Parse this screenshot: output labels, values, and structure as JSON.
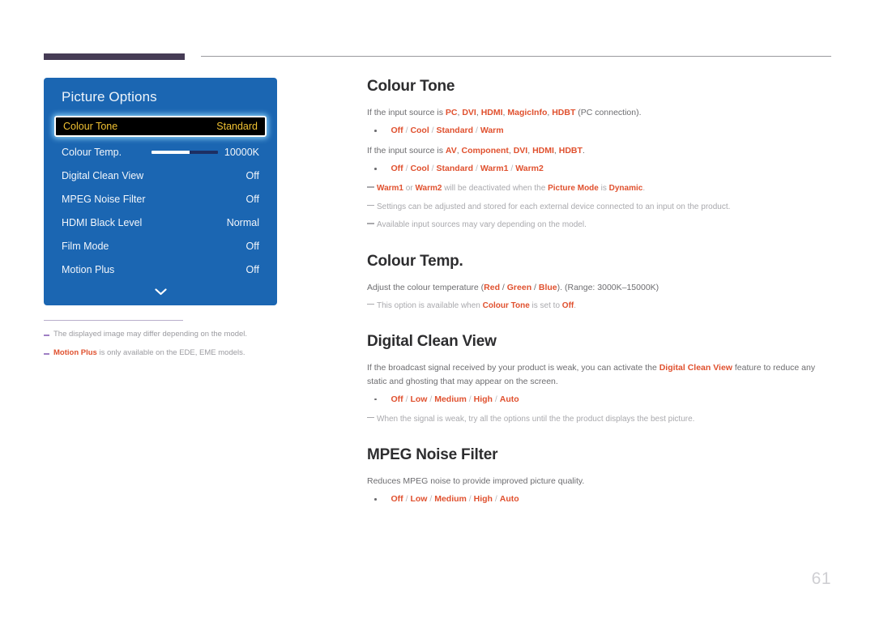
{
  "page": {
    "number": "61"
  },
  "osd": {
    "title": "Picture Options",
    "rows": [
      {
        "label": "Colour Tone",
        "value": "Standard",
        "selected": true,
        "slider": false
      },
      {
        "label": "Colour Temp.",
        "value": "10000K",
        "selected": false,
        "slider": true
      },
      {
        "label": "Digital Clean View",
        "value": "Off",
        "selected": false,
        "slider": false
      },
      {
        "label": "MPEG Noise Filter",
        "value": "Off",
        "selected": false,
        "slider": false
      },
      {
        "label": "HDMI Black Level",
        "value": "Normal",
        "selected": false,
        "slider": false
      },
      {
        "label": "Film Mode",
        "value": "Off",
        "selected": false,
        "slider": false
      },
      {
        "label": "Motion Plus",
        "value": "Off",
        "selected": false,
        "slider": false
      }
    ],
    "scroll_icon": "chevron-down-icon"
  },
  "left_notes": [
    {
      "text": "The displayed image may differ depending on the model.",
      "highlight": ""
    },
    {
      "text": " is only available on the EDE, EME models.",
      "highlight": "Motion Plus"
    }
  ],
  "sections": [
    {
      "title": "Colour Tone",
      "lines": [
        {
          "kind": "body",
          "parts": [
            {
              "t": "If the input source is ",
              "em": false
            },
            {
              "t": "PC",
              "em": true
            },
            {
              "t": ", ",
              "em": false
            },
            {
              "t": "DVI",
              "em": true
            },
            {
              "t": ", ",
              "em": false
            },
            {
              "t": "HDMI",
              "em": true
            },
            {
              "t": ", ",
              "em": false
            },
            {
              "t": "MagicInfo",
              "em": true
            },
            {
              "t": ", ",
              "em": false
            },
            {
              "t": "HDBT",
              "em": true
            },
            {
              "t": " (PC connection).",
              "em": false
            }
          ]
        },
        {
          "kind": "bullet",
          "options": [
            "Off",
            "Cool",
            "Standard",
            "Warm"
          ]
        },
        {
          "kind": "body",
          "parts": [
            {
              "t": "If the input source is ",
              "em": false
            },
            {
              "t": "AV",
              "em": true
            },
            {
              "t": ", ",
              "em": false
            },
            {
              "t": "Component",
              "em": true
            },
            {
              "t": ", ",
              "em": false
            },
            {
              "t": "DVI",
              "em": true
            },
            {
              "t": ", ",
              "em": false
            },
            {
              "t": "HDMI",
              "em": true
            },
            {
              "t": ", ",
              "em": false
            },
            {
              "t": "HDBT",
              "em": true
            },
            {
              "t": ".",
              "em": false
            }
          ]
        },
        {
          "kind": "bullet",
          "options": [
            "Off",
            "Cool",
            "Standard",
            "Warm1",
            "Warm2"
          ]
        },
        {
          "kind": "dash",
          "parts": [
            {
              "t": "Warm1",
              "em": true
            },
            {
              "t": " or ",
              "em": false
            },
            {
              "t": "Warm2",
              "em": true
            },
            {
              "t": " will be deactivated when the ",
              "em": false
            },
            {
              "t": "Picture Mode",
              "em": true
            },
            {
              "t": " is ",
              "em": false
            },
            {
              "t": "Dynamic",
              "em": true
            },
            {
              "t": ".",
              "em": false
            }
          ]
        },
        {
          "kind": "dash",
          "parts": [
            {
              "t": "Settings can be adjusted and stored for each external device connected to an input on the product.",
              "em": false
            }
          ]
        },
        {
          "kind": "dash",
          "parts": [
            {
              "t": "Available input sources may vary depending on the model.",
              "em": false
            }
          ]
        }
      ]
    },
    {
      "title": "Colour Temp.",
      "lines": [
        {
          "kind": "body",
          "parts": [
            {
              "t": "Adjust the colour temperature (",
              "em": false
            },
            {
              "t": "Red",
              "em": true
            },
            {
              "t": " / ",
              "em": false
            },
            {
              "t": "Green",
              "em": true
            },
            {
              "t": " / ",
              "em": false
            },
            {
              "t": "Blue",
              "em": true
            },
            {
              "t": "). (Range: 3000K–15000K)",
              "em": false
            }
          ]
        },
        {
          "kind": "dash",
          "parts": [
            {
              "t": "This option is available when ",
              "em": false
            },
            {
              "t": "Colour Tone",
              "em": true
            },
            {
              "t": " is set to ",
              "em": false
            },
            {
              "t": "Off",
              "em": true
            },
            {
              "t": ".",
              "em": false
            }
          ]
        }
      ]
    },
    {
      "title": "Digital Clean View",
      "lines": [
        {
          "kind": "body",
          "parts": [
            {
              "t": "If the broadcast signal received by your product is weak, you can activate the ",
              "em": false
            },
            {
              "t": "Digital Clean View",
              "em": true
            },
            {
              "t": " feature to reduce any static and ghosting that may appear on the screen.",
              "em": false
            }
          ]
        },
        {
          "kind": "bullet",
          "options": [
            "Off",
            "Low",
            "Medium",
            "High",
            "Auto"
          ]
        },
        {
          "kind": "dash",
          "parts": [
            {
              "t": "When the signal is weak, try all the options until the the product displays the best picture.",
              "em": false
            }
          ]
        }
      ]
    },
    {
      "title": "MPEG Noise Filter",
      "lines": [
        {
          "kind": "body",
          "parts": [
            {
              "t": "Reduces MPEG noise to provide improved picture quality.",
              "em": false
            }
          ]
        },
        {
          "kind": "bullet",
          "options": [
            "Off",
            "Low",
            "Medium",
            "High",
            "Auto"
          ]
        }
      ]
    }
  ],
  "colors": {
    "osd_blue": "#1b66b2",
    "osd_selected_bg": "#000000",
    "osd_selected_text": "#f0c132",
    "accent_orange": "#e0512f",
    "rule_purple": "#463c55",
    "note_dash_purple": "#9f7fc4"
  }
}
